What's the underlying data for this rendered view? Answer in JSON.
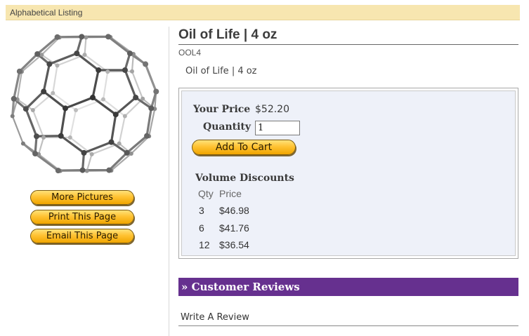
{
  "breadcrumb": {
    "label": "Alphabetical Listing"
  },
  "sidebar": {
    "buttons": [
      "More Pictures",
      "Print This Page",
      "Email This Page"
    ]
  },
  "product": {
    "title": "Oil of Life | 4 oz",
    "sku": "OOL4",
    "subname": "Oil of Life | 4 oz",
    "price_label": "Your Price",
    "price": "$52.20",
    "quantity_label": "Quantity",
    "quantity_value": "1",
    "add_to_cart": "Add To Cart"
  },
  "volume_discounts": {
    "title": "Volume Discounts",
    "headers": [
      "Qty",
      "Price"
    ],
    "rows": [
      {
        "qty": "3",
        "price": "$46.98"
      },
      {
        "qty": "6",
        "price": "$41.76"
      },
      {
        "qty": "12",
        "price": "$36.54"
      }
    ]
  },
  "reviews": {
    "header": "» Customer Reviews",
    "write_review": "Write A Review"
  },
  "colors": {
    "header_bar": "#f7e6b0",
    "price_panel": "#eef1f9",
    "reviews_bar": "#66308f",
    "button_gold": "#ffc233"
  }
}
